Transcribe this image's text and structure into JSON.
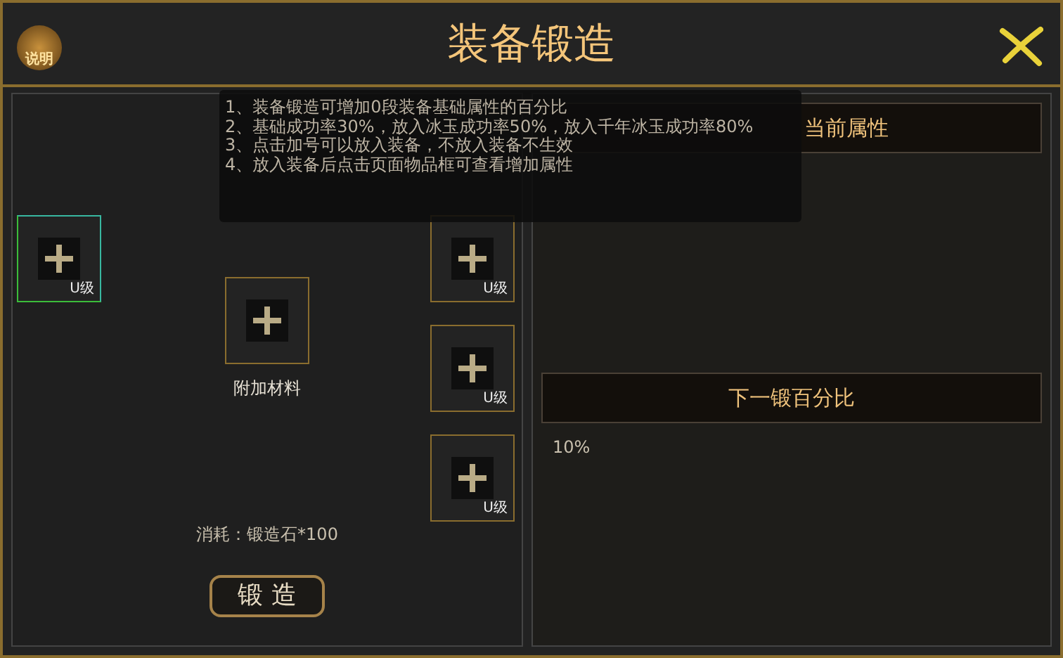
{
  "window": {
    "title": "装备锻造",
    "help_label": "说明"
  },
  "tooltip": {
    "lines": [
      "1、装备锻造可增加0段装备基础属性的百分比",
      "2、基础成功率30%，放入冰玉成功率50%，放入千年冰玉成功率80%",
      "3、点击加号可以放入装备，不放入装备不生效",
      "4、放入装备后点击页面物品框可查看增加属性"
    ]
  },
  "forge": {
    "main_slot": {
      "grade": "U级",
      "selected": true
    },
    "extra_slot": {
      "label": "附加材料"
    },
    "material_slots": [
      {
        "grade": "U级",
        "selected": false
      },
      {
        "grade": "U级",
        "selected": false
      },
      {
        "grade": "U级",
        "selected": false
      }
    ],
    "cost": "消耗：锻造石*100",
    "button": "锻 造"
  },
  "attributes": {
    "current_header": "当前属性",
    "next_header": "下一锻百分比",
    "next_value": "10%"
  }
}
